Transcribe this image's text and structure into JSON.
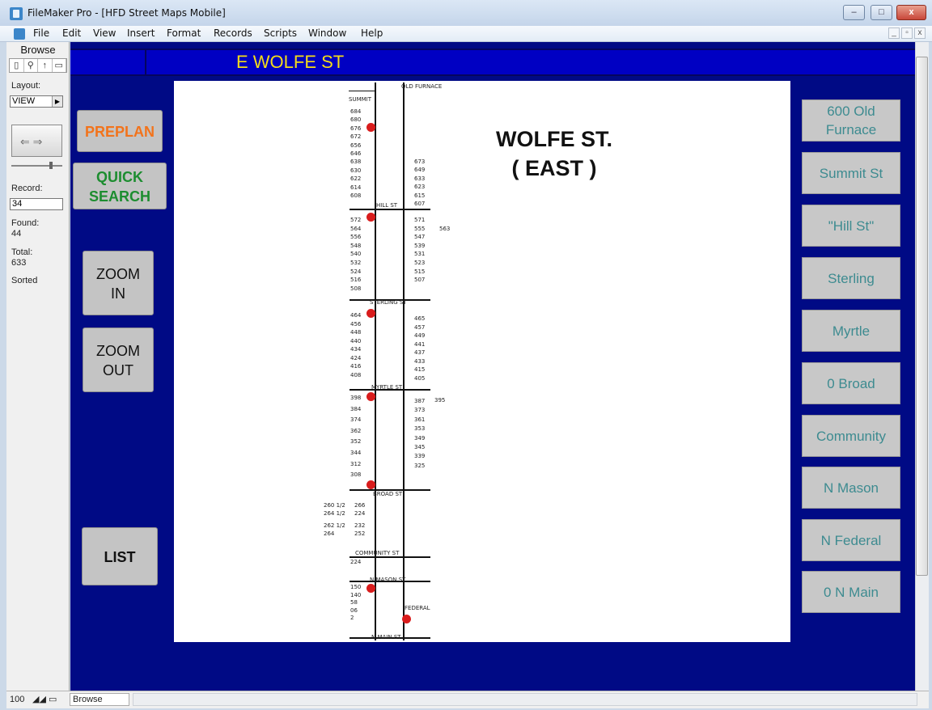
{
  "window": {
    "title": "FileMaker Pro - [HFD Street Maps Mobile]",
    "minimize": "–",
    "maximize": "□",
    "close": "x"
  },
  "menubar": {
    "items": [
      "File",
      "Edit",
      "View",
      "Insert",
      "Format",
      "Records",
      "Scripts",
      "Window",
      "Help"
    ],
    "mdi": [
      "_",
      "▫",
      "x"
    ]
  },
  "status_area": {
    "mode": "Browse",
    "tools": [
      "▯",
      "⚲",
      "↑",
      "▭"
    ],
    "layout_label": "Layout:",
    "layout_value": "VIEW",
    "record_label": "Record:",
    "record_value": "34",
    "found_label": "Found:",
    "found_value": "44",
    "total_label": "Total:",
    "total_value": "633",
    "sorted_label": "Sorted"
  },
  "header": {
    "street_name": "E WOLFE ST"
  },
  "buttons": {
    "preplan": "PREPLAN",
    "quick_search_1": "QUICK",
    "quick_search_2": "SEARCH",
    "zoom_in_1": "ZOOM",
    "zoom_in_2": "IN",
    "zoom_out_1": "ZOOM",
    "zoom_out_2": "OUT",
    "list": "LIST"
  },
  "cross_streets": [
    "600 Old Furnace",
    "Summit St",
    "\"Hill St\"",
    "Sterling",
    "Myrtle",
    "0 Broad",
    "Community",
    "N Mason",
    "N Federal",
    "0 N Main"
  ],
  "map": {
    "title_1": "WOLFE   ST.",
    "title_2": "( EAST )",
    "street_labels": [
      "OLD FURNACE",
      "SUMMIT",
      "HILL  ST",
      "STERLING  ST",
      "MYRTLE  ST",
      "BROAD  ST",
      "COMMUNITY  ST",
      "N MASON  ST",
      "FEDERAL",
      "N MAIN  ST"
    ],
    "left_block1": [
      "684",
      "680",
      "676",
      "672",
      "656",
      "646",
      "638",
      "630",
      "622",
      "614",
      "608"
    ],
    "right_block1": [
      "673",
      "649",
      "633",
      "623",
      "615",
      "607"
    ],
    "left_block2": [
      "572",
      "564",
      "556",
      "548",
      "540",
      "532",
      "524",
      "516",
      "508"
    ],
    "right_block2": [
      "571",
      "555",
      "547",
      "539",
      "531",
      "523",
      "515",
      "507"
    ],
    "right_extra2": "563",
    "left_block3": [
      "464",
      "456",
      "448",
      "440",
      "434",
      "424",
      "416",
      "408"
    ],
    "right_block3": [
      "465",
      "457",
      "449",
      "441",
      "437",
      "433",
      "415",
      "405"
    ],
    "left_block4": [
      "398",
      "384",
      "374",
      "362",
      "352",
      "344",
      "312",
      "308"
    ],
    "right_block4": [
      "387",
      "373",
      "361",
      "353",
      "349",
      "345",
      "339",
      "325"
    ],
    "right_extra4": "395",
    "left_block5": [
      "260 1/2",
      "266",
      "264 1/2",
      "224",
      "262 1/2",
      "232",
      "264",
      "252"
    ],
    "left_block6": [
      "224"
    ],
    "left_block7": [
      "150",
      "140",
      "58",
      "06",
      "2"
    ]
  },
  "bottombar": {
    "zoom": "100",
    "mode": "Browse"
  }
}
